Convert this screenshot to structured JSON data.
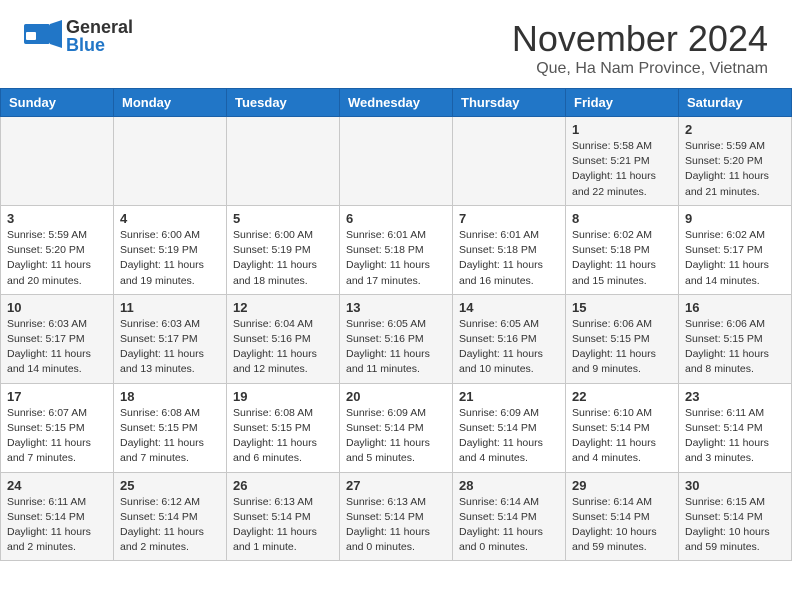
{
  "header": {
    "logo_general": "General",
    "logo_blue": "Blue",
    "title": "November 2024",
    "location": "Que, Ha Nam Province, Vietnam"
  },
  "weekdays": [
    "Sunday",
    "Monday",
    "Tuesday",
    "Wednesday",
    "Thursday",
    "Friday",
    "Saturday"
  ],
  "weeks": [
    [
      {
        "day": "",
        "info": ""
      },
      {
        "day": "",
        "info": ""
      },
      {
        "day": "",
        "info": ""
      },
      {
        "day": "",
        "info": ""
      },
      {
        "day": "",
        "info": ""
      },
      {
        "day": "1",
        "info": "Sunrise: 5:58 AM\nSunset: 5:21 PM\nDaylight: 11 hours\nand 22 minutes."
      },
      {
        "day": "2",
        "info": "Sunrise: 5:59 AM\nSunset: 5:20 PM\nDaylight: 11 hours\nand 21 minutes."
      }
    ],
    [
      {
        "day": "3",
        "info": "Sunrise: 5:59 AM\nSunset: 5:20 PM\nDaylight: 11 hours\nand 20 minutes."
      },
      {
        "day": "4",
        "info": "Sunrise: 6:00 AM\nSunset: 5:19 PM\nDaylight: 11 hours\nand 19 minutes."
      },
      {
        "day": "5",
        "info": "Sunrise: 6:00 AM\nSunset: 5:19 PM\nDaylight: 11 hours\nand 18 minutes."
      },
      {
        "day": "6",
        "info": "Sunrise: 6:01 AM\nSunset: 5:18 PM\nDaylight: 11 hours\nand 17 minutes."
      },
      {
        "day": "7",
        "info": "Sunrise: 6:01 AM\nSunset: 5:18 PM\nDaylight: 11 hours\nand 16 minutes."
      },
      {
        "day": "8",
        "info": "Sunrise: 6:02 AM\nSunset: 5:18 PM\nDaylight: 11 hours\nand 15 minutes."
      },
      {
        "day": "9",
        "info": "Sunrise: 6:02 AM\nSunset: 5:17 PM\nDaylight: 11 hours\nand 14 minutes."
      }
    ],
    [
      {
        "day": "10",
        "info": "Sunrise: 6:03 AM\nSunset: 5:17 PM\nDaylight: 11 hours\nand 14 minutes."
      },
      {
        "day": "11",
        "info": "Sunrise: 6:03 AM\nSunset: 5:17 PM\nDaylight: 11 hours\nand 13 minutes."
      },
      {
        "day": "12",
        "info": "Sunrise: 6:04 AM\nSunset: 5:16 PM\nDaylight: 11 hours\nand 12 minutes."
      },
      {
        "day": "13",
        "info": "Sunrise: 6:05 AM\nSunset: 5:16 PM\nDaylight: 11 hours\nand 11 minutes."
      },
      {
        "day": "14",
        "info": "Sunrise: 6:05 AM\nSunset: 5:16 PM\nDaylight: 11 hours\nand 10 minutes."
      },
      {
        "day": "15",
        "info": "Sunrise: 6:06 AM\nSunset: 5:15 PM\nDaylight: 11 hours\nand 9 minutes."
      },
      {
        "day": "16",
        "info": "Sunrise: 6:06 AM\nSunset: 5:15 PM\nDaylight: 11 hours\nand 8 minutes."
      }
    ],
    [
      {
        "day": "17",
        "info": "Sunrise: 6:07 AM\nSunset: 5:15 PM\nDaylight: 11 hours\nand 7 minutes."
      },
      {
        "day": "18",
        "info": "Sunrise: 6:08 AM\nSunset: 5:15 PM\nDaylight: 11 hours\nand 7 minutes."
      },
      {
        "day": "19",
        "info": "Sunrise: 6:08 AM\nSunset: 5:15 PM\nDaylight: 11 hours\nand 6 minutes."
      },
      {
        "day": "20",
        "info": "Sunrise: 6:09 AM\nSunset: 5:14 PM\nDaylight: 11 hours\nand 5 minutes."
      },
      {
        "day": "21",
        "info": "Sunrise: 6:09 AM\nSunset: 5:14 PM\nDaylight: 11 hours\nand 4 minutes."
      },
      {
        "day": "22",
        "info": "Sunrise: 6:10 AM\nSunset: 5:14 PM\nDaylight: 11 hours\nand 4 minutes."
      },
      {
        "day": "23",
        "info": "Sunrise: 6:11 AM\nSunset: 5:14 PM\nDaylight: 11 hours\nand 3 minutes."
      }
    ],
    [
      {
        "day": "24",
        "info": "Sunrise: 6:11 AM\nSunset: 5:14 PM\nDaylight: 11 hours\nand 2 minutes."
      },
      {
        "day": "25",
        "info": "Sunrise: 6:12 AM\nSunset: 5:14 PM\nDaylight: 11 hours\nand 2 minutes."
      },
      {
        "day": "26",
        "info": "Sunrise: 6:13 AM\nSunset: 5:14 PM\nDaylight: 11 hours\nand 1 minute."
      },
      {
        "day": "27",
        "info": "Sunrise: 6:13 AM\nSunset: 5:14 PM\nDaylight: 11 hours\nand 0 minutes."
      },
      {
        "day": "28",
        "info": "Sunrise: 6:14 AM\nSunset: 5:14 PM\nDaylight: 11 hours\nand 0 minutes."
      },
      {
        "day": "29",
        "info": "Sunrise: 6:14 AM\nSunset: 5:14 PM\nDaylight: 10 hours\nand 59 minutes."
      },
      {
        "day": "30",
        "info": "Sunrise: 6:15 AM\nSunset: 5:14 PM\nDaylight: 10 hours\nand 59 minutes."
      }
    ]
  ]
}
